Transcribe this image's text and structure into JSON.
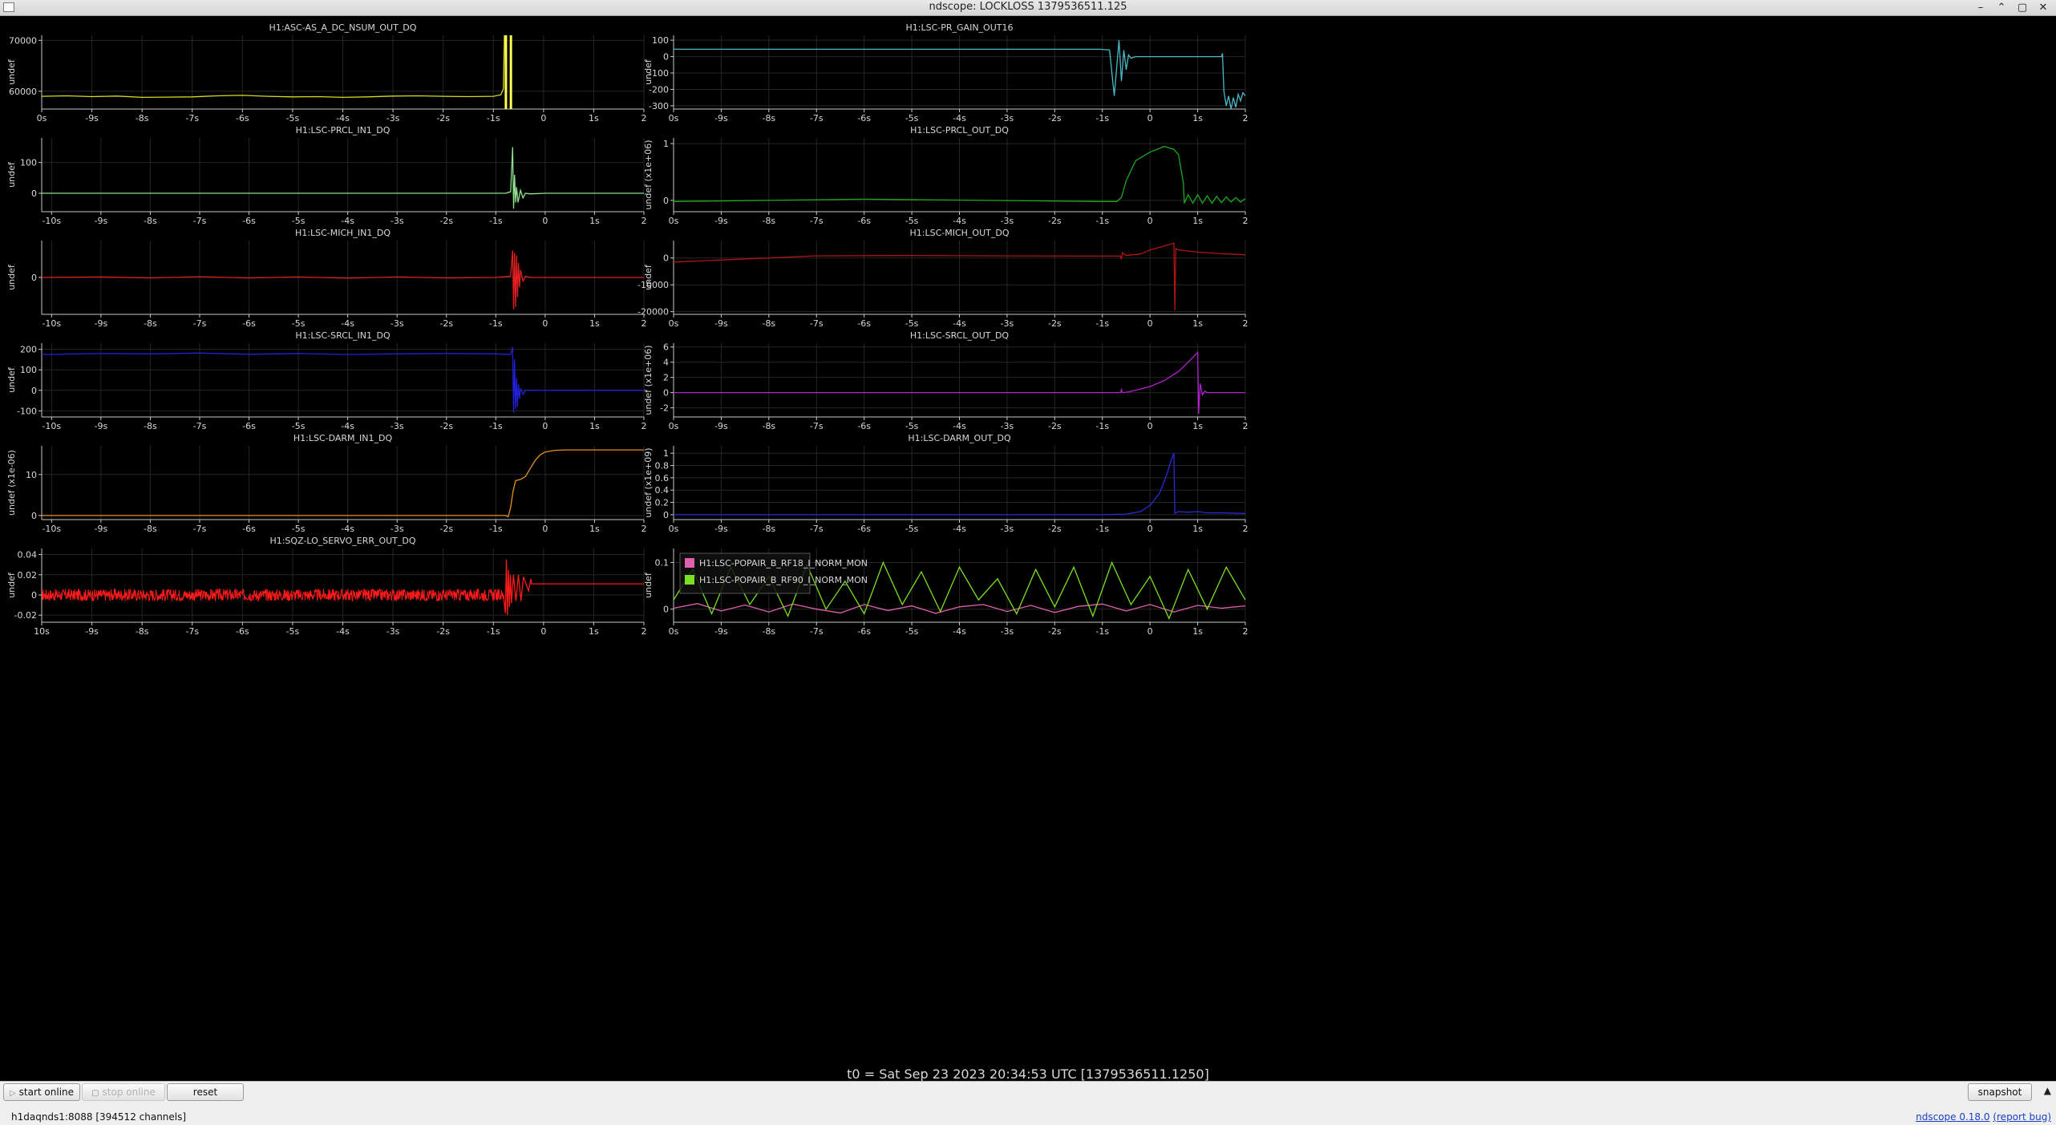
{
  "window": {
    "title": "ndscope: LOCKLOSS 1379536511.125",
    "buttons": [
      "–",
      "⌃",
      "▢",
      "✕"
    ]
  },
  "t0_label": "t0 = Sat Sep 23 2023 20:34:53 UTC [1379536511.1250]",
  "toolbar": {
    "start_online": "start online",
    "stop_online": "stop online",
    "reset": "reset",
    "snapshot": "snapshot"
  },
  "status": {
    "server": "h1daqnds1:8088  [394512 channels]",
    "version": "ndscope 0.18.0",
    "report_bug": "(report bug)"
  },
  "colors": {
    "background": "#000000",
    "grid": "#262626",
    "axis": "#c8c8c8",
    "label": "#d8d8d8"
  },
  "chart_data": [
    {
      "type": "line",
      "title": "H1:ASC-AS_A_DC_NSUM_OUT_DQ",
      "ylabel": "undef",
      "xticks": [
        "0s",
        "-9s",
        "-8s",
        "-7s",
        "-6s",
        "-5s",
        "-4s",
        "-3s",
        "-2s",
        "-1s",
        "0",
        "1s",
        "2"
      ],
      "xlim": [
        -10,
        2
      ],
      "ylim": [
        56500,
        71000
      ],
      "yticks": [
        60000,
        70000
      ],
      "ytick_labels": [
        "60000",
        "70000"
      ],
      "series": [
        {
          "color": "#d9d91a",
          "x": [
            -10,
            -9.5,
            -9,
            -8.5,
            -8,
            -7.5,
            -7,
            -6.5,
            -6,
            -5.5,
            -5,
            -4.5,
            -4,
            -3.5,
            -3,
            -2.5,
            -2,
            -1.5,
            -1,
            -0.85,
            -0.8,
            -0.78,
            -0.75
          ],
          "y": [
            59000,
            59100,
            58950,
            59050,
            58800,
            58850,
            58900,
            59100,
            59200,
            59000,
            58900,
            58950,
            58800,
            58900,
            59050,
            59100,
            59000,
            58950,
            59000,
            59300,
            60500,
            71000,
            71000
          ]
        }
      ],
      "verticals": [
        {
          "x": -0.75,
          "color": "#ffff55"
        },
        {
          "x": -0.65,
          "color": "#ffff55"
        }
      ]
    },
    {
      "type": "line",
      "title": "H1:LSC-PR_GAIN_OUT16",
      "ylabel": "undef",
      "xticks": [
        "0s",
        "-9s",
        "-8s",
        "-7s",
        "-6s",
        "-5s",
        "-4s",
        "-3s",
        "-2s",
        "-1s",
        "0",
        "1s",
        "2"
      ],
      "xlim": [
        -10,
        2
      ],
      "ylim": [
        -320,
        130
      ],
      "yticks": [
        100,
        0,
        -100,
        -200,
        -300
      ],
      "ytick_labels": [
        "100",
        "0",
        "-100",
        "-200",
        "-300"
      ],
      "series": [
        {
          "color": "#4ab8c8",
          "x": [
            -10,
            -1.5,
            -1.05,
            -0.85,
            -0.75,
            -0.65,
            -0.6,
            -0.55,
            -0.5,
            -0.45,
            -0.4,
            -0.3,
            -0.2,
            0,
            0.5,
            1.0,
            1.5,
            1.52,
            1.55,
            1.6,
            1.65,
            1.7,
            1.75,
            1.8,
            1.85,
            1.9,
            1.95,
            2.0
          ],
          "y": [
            45,
            45,
            45,
            40,
            -240,
            100,
            -150,
            40,
            -80,
            10,
            -10,
            0,
            0,
            0,
            0,
            0,
            0,
            20,
            -210,
            -300,
            -240,
            -320,
            -250,
            -310,
            -230,
            -270,
            -220,
            -240
          ]
        }
      ]
    },
    {
      "type": "line",
      "title": "H1:LSC-PRCL_IN1_DQ",
      "ylabel": "undef",
      "xticks": [
        "-10s",
        "-9s",
        "-8s",
        "-7s",
        "-6s",
        "-5s",
        "-4s",
        "-3s",
        "-2s",
        "-1s",
        "0",
        "1s",
        "2"
      ],
      "xlim": [
        -10.2,
        2
      ],
      "ylim": [
        -60,
        180
      ],
      "yticks": [
        0,
        100
      ],
      "ytick_labels": [
        "0",
        "100"
      ],
      "series": [
        {
          "color": "#8ee08e",
          "x": [
            -10.2,
            -1.5,
            -0.8,
            -0.7,
            -0.66,
            -0.64,
            -0.62,
            -0.6,
            -0.58,
            -0.55,
            -0.5,
            -0.45,
            -0.4,
            -0.3,
            0,
            0.5,
            1.0,
            2.0
          ],
          "y": [
            0,
            0,
            0,
            5,
            150,
            -50,
            60,
            -30,
            20,
            -30,
            10,
            -15,
            0,
            -2,
            0,
            0,
            0,
            0
          ]
        }
      ]
    },
    {
      "type": "line",
      "title": "H1:LSC-PRCL_OUT_DQ",
      "ylabel": "undef (x1e+06)",
      "xticks": [
        "0s",
        "-9s",
        "-8s",
        "-7s",
        "-6s",
        "-5s",
        "-4s",
        "-3s",
        "-2s",
        "-1s",
        "0",
        "1s",
        "2"
      ],
      "xlim": [
        -10,
        2
      ],
      "ylim": [
        -0.2,
        1.1
      ],
      "yticks": [
        0,
        1
      ],
      "ytick_labels": [
        "0",
        "1"
      ],
      "series": [
        {
          "color": "#1fa81f",
          "x": [
            -10,
            -6,
            -1.0,
            -0.7,
            -0.6,
            -0.5,
            -0.3,
            0,
            0.3,
            0.5,
            0.6,
            0.7,
            0.72,
            0.8,
            0.9,
            1.0,
            1.1,
            1.2,
            1.3,
            1.4,
            1.5,
            1.6,
            1.7,
            1.8,
            1.9,
            2.0
          ],
          "y": [
            -0.02,
            0.02,
            -0.02,
            -0.02,
            0.05,
            0.35,
            0.7,
            0.85,
            0.95,
            0.9,
            0.8,
            0.3,
            -0.05,
            0.1,
            -0.05,
            0.1,
            -0.05,
            0.08,
            -0.05,
            0.07,
            -0.04,
            0.06,
            -0.03,
            0.05,
            -0.03,
            0.03
          ]
        }
      ]
    },
    {
      "type": "line",
      "title": "H1:LSC-MICH_IN1_DQ",
      "ylabel": "undef",
      "xticks": [
        "-10s",
        "-9s",
        "-8s",
        "-7s",
        "-6s",
        "-5s",
        "-4s",
        "-3s",
        "-2s",
        "-1s",
        "0",
        "1s",
        "2"
      ],
      "xlim": [
        -10.2,
        2
      ],
      "ylim": [
        -150,
        150
      ],
      "yticks": [
        0
      ],
      "ytick_labels": [
        "0"
      ],
      "series": [
        {
          "color": "#e02020",
          "x": [
            -10.2,
            -9,
            -8,
            -7,
            -6,
            -5,
            -4,
            -3,
            -2,
            -1,
            -0.7,
            -0.66,
            -0.64,
            -0.62,
            -0.6,
            -0.58,
            -0.56,
            -0.54,
            -0.52,
            -0.5,
            -0.45,
            -0.4,
            -0.3,
            0,
            1,
            2
          ],
          "y": [
            0,
            2,
            -2,
            3,
            -2,
            2,
            -3,
            2,
            -2,
            0,
            5,
            110,
            -130,
            100,
            -120,
            90,
            -80,
            60,
            -40,
            30,
            -15,
            5,
            0,
            0,
            0,
            0
          ]
        }
      ]
    },
    {
      "type": "line",
      "title": "H1:LSC-MICH_OUT_DQ",
      "ylabel": "undef",
      "xticks": [
        "0s",
        "-9s",
        "-8s",
        "-7s",
        "-6s",
        "-5s",
        "-4s",
        "-3s",
        "-2s",
        "-1s",
        "0",
        "1s",
        "2"
      ],
      "xlim": [
        -10,
        2
      ],
      "ylim": [
        -21000,
        6500
      ],
      "yticks": [
        0,
        -10000,
        -20000
      ],
      "ytick_labels": [
        "0",
        "-10000",
        "-20000"
      ],
      "series": [
        {
          "color": "#b01515",
          "x": [
            -10,
            -8,
            -7,
            -5,
            -3,
            -1.5,
            -0.62,
            -0.6,
            -0.58,
            -0.5,
            -0.2,
            0,
            0.3,
            0.5,
            0.52,
            0.54,
            0.6,
            0.8,
            1.0,
            1.5,
            2.0
          ],
          "y": [
            -1500,
            0,
            800,
            900,
            800,
            700,
            700,
            -500,
            2000,
            900,
            1500,
            3000,
            4500,
            5500,
            -19500,
            3500,
            3000,
            2600,
            2200,
            1600,
            1200
          ]
        }
      ]
    },
    {
      "type": "line",
      "title": "H1:LSC-SRCL_IN1_DQ",
      "ylabel": "undef",
      "xticks": [
        "-10s",
        "-9s",
        "-8s",
        "-7s",
        "-6s",
        "-5s",
        "-4s",
        "-3s",
        "-2s",
        "-1s",
        "0",
        "1s",
        "2"
      ],
      "xlim": [
        -10.2,
        2
      ],
      "ylim": [
        -130,
        230
      ],
      "yticks": [
        200,
        100,
        0,
        -100
      ],
      "ytick_labels": [
        "200",
        "100",
        "0",
        "-100"
      ],
      "series": [
        {
          "color": "#2020d8",
          "x": [
            -10.2,
            -9,
            -8,
            -7,
            -6,
            -5,
            -4,
            -3,
            -2,
            -1,
            -0.7,
            -0.66,
            -0.64,
            -0.62,
            -0.6,
            -0.58,
            -0.56,
            -0.54,
            -0.52,
            -0.5,
            -0.45,
            -0.4,
            0,
            1,
            2
          ],
          "y": [
            175,
            180,
            178,
            182,
            176,
            180,
            175,
            178,
            180,
            178,
            175,
            210,
            -110,
            150,
            -90,
            60,
            -80,
            30,
            -40,
            10,
            -20,
            0,
            0,
            0,
            0
          ]
        }
      ]
    },
    {
      "type": "line",
      "title": "H1:LSC-SRCL_OUT_DQ",
      "ylabel": "undef (x1e+06)",
      "xticks": [
        "0s",
        "-9s",
        "-8s",
        "-7s",
        "-6s",
        "-5s",
        "-4s",
        "-3s",
        "-2s",
        "-1s",
        "0",
        "1s",
        "2"
      ],
      "xlim": [
        -10,
        2
      ],
      "ylim": [
        -3.2,
        6.5
      ],
      "yticks": [
        6,
        4,
        2,
        0,
        -2
      ],
      "ytick_labels": [
        "6",
        "4",
        "2",
        "0",
        "-2"
      ],
      "series": [
        {
          "color": "#b020d0",
          "x": [
            -10,
            -1,
            -0.62,
            -0.6,
            -0.58,
            -0.5,
            -0.3,
            0,
            0.3,
            0.6,
            0.8,
            1.0,
            1.02,
            1.05,
            1.1,
            1.15,
            1.2,
            1.5,
            2.0
          ],
          "y": [
            0,
            0,
            0,
            0.4,
            0,
            0.05,
            0.3,
            0.8,
            1.6,
            2.8,
            4.0,
            5.3,
            -2.8,
            1.2,
            -0.3,
            0.2,
            0,
            0,
            0
          ]
        }
      ]
    },
    {
      "type": "line",
      "title": "H1:LSC-DARM_IN1_DQ",
      "ylabel": "undef (x1e-06)",
      "xticks": [
        "-10s",
        "-9s",
        "-8s",
        "-7s",
        "-6s",
        "-5s",
        "-4s",
        "-3s",
        "-2s",
        "-1s",
        "0",
        "1s",
        "2"
      ],
      "xlim": [
        -10.2,
        2
      ],
      "ylim": [
        -1,
        17
      ],
      "yticks": [
        0,
        10
      ],
      "ytick_labels": [
        "0",
        "10"
      ],
      "series": [
        {
          "color": "#e89020",
          "x": [
            -10.2,
            -1.0,
            -0.8,
            -0.75,
            -0.7,
            -0.65,
            -0.6,
            -0.5,
            -0.4,
            -0.3,
            -0.2,
            -0.1,
            0,
            0.2,
            0.4,
            0.7,
            1.0,
            2.0
          ],
          "y": [
            0,
            0,
            0,
            -0.3,
            2,
            6,
            8.5,
            8.8,
            9.5,
            11.5,
            13.5,
            14.8,
            15.5,
            15.9,
            16,
            16,
            16,
            16
          ]
        }
      ]
    },
    {
      "type": "line",
      "title": "H1:LSC-DARM_OUT_DQ",
      "ylabel": "undef (x1e+09)",
      "xticks": [
        "0s",
        "-9s",
        "-8s",
        "-7s",
        "-6s",
        "-5s",
        "-4s",
        "-3s",
        "-2s",
        "-1s",
        "0",
        "1s",
        "2"
      ],
      "xlim": [
        -10,
        2
      ],
      "ylim": [
        -0.08,
        1.12
      ],
      "yticks": [
        1,
        0.8,
        0.6,
        0.4,
        0.2,
        0
      ],
      "ytick_labels": [
        "1",
        "0.8",
        "0.6",
        "0.4",
        "0.2",
        "0"
      ],
      "series": [
        {
          "color": "#2a2ad8",
          "x": [
            -10,
            -1.0,
            -0.5,
            -0.2,
            0,
            0.2,
            0.35,
            0.45,
            0.5,
            0.52,
            0.6,
            0.8,
            1.0,
            1.2,
            1.5,
            2.0
          ],
          "y": [
            0,
            0,
            0.01,
            0.05,
            0.15,
            0.35,
            0.65,
            0.9,
            1.0,
            0.02,
            0.05,
            0.04,
            0.05,
            0.03,
            0.03,
            0.02
          ]
        }
      ]
    },
    {
      "type": "line",
      "title": "H1:SQZ-LO_SERVO_ERR_OUT_DQ",
      "ylabel": "undef",
      "xticks": [
        "10s",
        "-9s",
        "-8s",
        "-7s",
        "-6s",
        "-5s",
        "-4s",
        "-3s",
        "-2s",
        "-1s",
        "0",
        "1s",
        "2"
      ],
      "xlim": [
        -10,
        2
      ],
      "ylim": [
        -0.027,
        0.046
      ],
      "yticks": [
        0.04,
        0.02,
        0,
        -0.02
      ],
      "ytick_labels": [
        "0.04",
        "0.02",
        "0",
        "-0.02"
      ],
      "series": [
        {
          "color": "#ff1a1a",
          "noise_band": {
            "x_start": -10,
            "x_end": -0.8,
            "center": 0.0,
            "amplitude": 0.006
          },
          "x": [
            -0.8,
            -0.76,
            -0.74,
            -0.72,
            -0.7,
            -0.68,
            -0.66,
            -0.64,
            -0.6,
            -0.55,
            -0.5,
            -0.45,
            -0.4,
            -0.3,
            -0.25,
            -0.24,
            0,
            1,
            2
          ],
          "y": [
            0,
            -0.018,
            0.035,
            -0.02,
            0.025,
            -0.012,
            0.02,
            -0.008,
            0.02,
            -0.006,
            0.02,
            -0.006,
            0.018,
            0.004,
            0.016,
            0.011,
            0.011,
            0.011,
            0.011
          ]
        }
      ]
    },
    {
      "type": "line",
      "title": "",
      "ylabel": "undef",
      "xticks": [
        "0s",
        "-9s",
        "-8s",
        "-7s",
        "-6s",
        "-5s",
        "-4s",
        "-3s",
        "-2s",
        "-1s",
        "0",
        "1s",
        "2"
      ],
      "xlim": [
        -10,
        2
      ],
      "ylim": [
        -0.028,
        0.13
      ],
      "yticks": [
        0.1,
        0
      ],
      "ytick_labels": [
        "0.1",
        "0"
      ],
      "legend": "top-left",
      "series": [
        {
          "name": "H1:LSC-POPAIR_B_RF18_I_NORM_MON",
          "color": "#e060b0",
          "x": [
            -10,
            -9.5,
            -9,
            -8.5,
            -8,
            -7.5,
            -7,
            -6.5,
            -6,
            -5.5,
            -5,
            -4.5,
            -4,
            -3.5,
            -3,
            -2.5,
            -2,
            -1.5,
            -1,
            -0.5,
            0,
            0.5,
            1,
            1.5,
            2
          ],
          "y": [
            0.002,
            0.012,
            -0.004,
            0.009,
            -0.006,
            0.011,
            0.0,
            -0.008,
            0.01,
            -0.003,
            0.007,
            -0.009,
            0.005,
            0.01,
            -0.005,
            0.008,
            -0.007,
            0.006,
            0.011,
            -0.004,
            0.01,
            -0.006,
            0.008,
            0.002,
            0.007
          ]
        },
        {
          "name": "H1:LSC-POPAIR_B_RF90_I_NORM_MON",
          "color": "#7be020",
          "x": [
            -10,
            -9.6,
            -9.2,
            -8.8,
            -8.4,
            -8,
            -7.6,
            -7.2,
            -6.8,
            -6.4,
            -6,
            -5.6,
            -5.2,
            -4.8,
            -4.4,
            -4,
            -3.6,
            -3.2,
            -2.8,
            -2.4,
            -2,
            -1.6,
            -1.2,
            -0.8,
            -0.4,
            0,
            0.4,
            0.8,
            1.2,
            1.6,
            2
          ],
          "y": [
            0.02,
            0.085,
            -0.01,
            0.09,
            0.01,
            0.07,
            -0.015,
            0.095,
            0.0,
            0.06,
            -0.01,
            0.1,
            0.01,
            0.08,
            -0.005,
            0.09,
            0.02,
            0.065,
            -0.01,
            0.085,
            0.005,
            0.09,
            -0.015,
            0.1,
            0.01,
            0.07,
            -0.02,
            0.085,
            0.0,
            0.09,
            0.02
          ]
        }
      ]
    }
  ]
}
